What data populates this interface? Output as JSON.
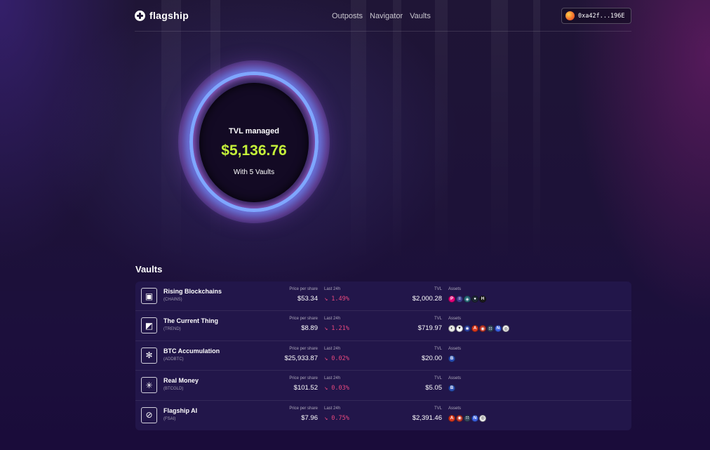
{
  "header": {
    "brand": "flagship",
    "nav": [
      "Outposts",
      "Navigator",
      "Vaults"
    ],
    "wallet_address": "0xa42f...196E"
  },
  "hero": {
    "tvl_label": "TVL managed",
    "tvl_value": "$5,136.76",
    "tvl_sub": "With 5 Vaults"
  },
  "vaults": {
    "title": "Vaults",
    "column_labels": {
      "pps": "Price per share",
      "last24": "Last 24h",
      "tvl": "TVL",
      "assets": "Assets"
    },
    "rows": [
      {
        "name": "Rising Blockchains",
        "ticker": "(CHAINS)",
        "icon": "cube-icon",
        "icon_char": "▣",
        "pps": "$53.34",
        "last24": "↘ 1.49%",
        "tvl": "$2,000.28",
        "assets": [
          {
            "name": "polkadot-icon",
            "color": "#e6007a",
            "char": "P"
          },
          {
            "name": "asset-2-icon",
            "color": "#3d3d8f",
            "char": "≡"
          },
          {
            "name": "asset-3-icon",
            "color": "#2a6b7a",
            "char": "◈"
          },
          {
            "name": "asset-4-icon",
            "color": "#1f2a36",
            "char": "●"
          },
          {
            "name": "helium-icon",
            "color": "#1b1b1b",
            "char": "H"
          }
        ]
      },
      {
        "name": "The Current Thing",
        "ticker": "(TREND)",
        "icon": "trend-icon",
        "icon_char": "◩",
        "pps": "$8.89",
        "last24": "↘ 1.21%",
        "tvl": "$719.97",
        "assets": [
          {
            "name": "asset-a-icon",
            "color": "#e9e9e9",
            "char": "◐"
          },
          {
            "name": "asset-b-icon",
            "color": "#ffffff",
            "char": "▼"
          },
          {
            "name": "asset-c-icon",
            "color": "#2c3e9c",
            "char": "✱"
          },
          {
            "name": "asset-d-icon",
            "color": "#d9381e",
            "char": "A"
          },
          {
            "name": "asset-e-icon",
            "color": "#c0392b",
            "char": "◉"
          },
          {
            "name": "asset-f-icon",
            "color": "#34495e",
            "char": "∷"
          },
          {
            "name": "asset-g-icon",
            "color": "#3b5fe0",
            "char": "N"
          },
          {
            "name": "asset-h-icon",
            "color": "#f2f2f2",
            "char": "◎"
          }
        ]
      },
      {
        "name": "BTC Accumulation",
        "ticker": "(ADDBTC)",
        "icon": "flower-icon",
        "icon_char": "✻",
        "pps": "$25,933.87",
        "last24": "↘ 0.02%",
        "tvl": "$20.00",
        "assets": [
          {
            "name": "bitcoin-icon",
            "color": "#2b4fb3",
            "char": "B"
          }
        ]
      },
      {
        "name": "Real Money",
        "ticker": "(BTCGLD)",
        "icon": "asterisk-icon",
        "icon_char": "✳",
        "pps": "$101.52",
        "last24": "↘ 0.03%",
        "tvl": "$5.05",
        "assets": [
          {
            "name": "bitcoin-icon",
            "color": "#2b4fb3",
            "char": "B"
          }
        ]
      },
      {
        "name": "Flagship AI",
        "ticker": "(FSAI)",
        "icon": "ai-icon",
        "icon_char": "⊘",
        "pps": "$7.96",
        "last24": "↘ 0.75%",
        "tvl": "$2,391.46",
        "assets": [
          {
            "name": "asset-x-icon",
            "color": "#d9381e",
            "char": "A"
          },
          {
            "name": "asset-y-icon",
            "color": "#c0392b",
            "char": "◉"
          },
          {
            "name": "asset-z-icon",
            "color": "#34495e",
            "char": "∷"
          },
          {
            "name": "asset-w-icon",
            "color": "#3b5fe0",
            "char": "N"
          },
          {
            "name": "asset-v-icon",
            "color": "#f2f2f2",
            "char": "◎"
          }
        ]
      }
    ]
  },
  "colors": {
    "accent_green": "#c5f23a",
    "negative_red": "#e8487e",
    "card_bg": "#22164a"
  }
}
